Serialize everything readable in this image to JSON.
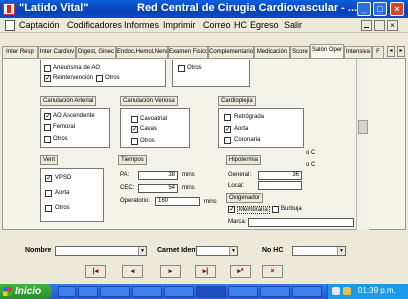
{
  "window": {
    "app_title": "\"Latido Vital\"",
    "system_title": "Red Central de Cirugia Cardiovascular - ..."
  },
  "menu": [
    "Captación",
    "Codificadores",
    "Informes",
    "Imprimir",
    "Correo",
    "HC",
    "Egreso",
    "Salir"
  ],
  "tabs": [
    "Inter Resp",
    "Inter Cardiov",
    "Digest, Ginec",
    "Endoc,Hemol,Nerv",
    "Examen Fisico",
    "Complementarios",
    "Medicación",
    "Score",
    "Salón Oper",
    "Intensiva",
    "F"
  ],
  "active_tab": "Salón Oper",
  "top_section": {
    "items": [
      {
        "label": "Aneurisma de AO",
        "checked": false
      },
      {
        "label": "Reintervención",
        "checked": true
      },
      {
        "label": "Otros",
        "checked": false
      }
    ],
    "right_items": [
      {
        "label": "Otros",
        "checked": false
      }
    ]
  },
  "canulacion_arterial": {
    "title": "Canulación Arterial",
    "items": [
      {
        "label": "AO Ascendente",
        "checked": true
      },
      {
        "label": "Femoral",
        "checked": false
      },
      {
        "label": "Otros",
        "checked": false
      }
    ]
  },
  "canulacion_venosa": {
    "title": "Canulación Venosa",
    "items": [
      {
        "label": "Cavoatrial",
        "checked": false
      },
      {
        "label": "Cavas",
        "checked": true
      },
      {
        "label": "Otros",
        "checked": false
      }
    ]
  },
  "cardioplejia": {
    "title": "Cardioplejia",
    "items": [
      {
        "label": "Retrógrada",
        "checked": false
      },
      {
        "label": "Aorta",
        "checked": true
      },
      {
        "label": "Coronaria",
        "checked": false
      }
    ]
  },
  "vent": {
    "title": "Vent",
    "items": [
      {
        "label": "VPSD",
        "checked": true
      },
      {
        "label": "Aorta",
        "checked": false
      },
      {
        "label": "Otros",
        "checked": false
      }
    ]
  },
  "tiempos": {
    "title": "Tiempos",
    "pa_label": "PA:",
    "pa_value": "38",
    "pa_unit": "mins",
    "cec_label": "CEC:",
    "cec_value": "54",
    "cec_unit": "mins",
    "op_label": "Operatorio:",
    "op_value": "160",
    "op_unit": "mins"
  },
  "hipotermia": {
    "title": "Hipotermia",
    "general_label": "General:",
    "general_value": "36",
    "general_unit": "o C",
    "local_label": "Local:",
    "local_unit": "o C"
  },
  "oxigenador": {
    "title": "Oxigenador",
    "items": [
      {
        "label": "Membrana",
        "checked": true
      },
      {
        "label": "Burbuja",
        "checked": false
      }
    ],
    "marca_label": "Marca:"
  },
  "filters": {
    "nombre_label": "Nombre",
    "carnet_label": "Carnet Ident",
    "nohc_label": "No HC"
  },
  "nav_buttons": [
    "first",
    "prev",
    "next",
    "last",
    "add",
    "undo"
  ],
  "taskbar": {
    "start_label": "Inicio",
    "clock": "01:39 p.m."
  }
}
